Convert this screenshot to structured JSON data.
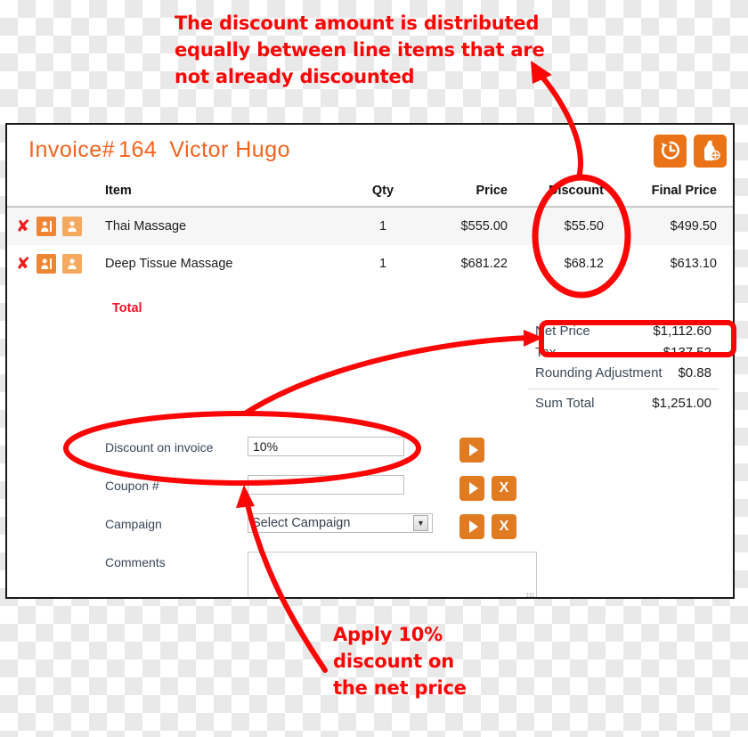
{
  "annotations": {
    "top_note": "The discount amount is distributed\nequally between line items that are\nnot already discounted",
    "bottom_note": "Apply 10%\ndiscount on\nthe net price",
    "color": "#fb0505"
  },
  "invoice": {
    "title_prefix": "Invoice#",
    "number": "164",
    "customer": "Victor Hugo",
    "title_color": "#f4631e",
    "header_buttons": [
      {
        "name": "history-button",
        "icon": "clock-history-icon"
      },
      {
        "name": "add-item-button",
        "icon": "bottle-plus-icon"
      }
    ],
    "table": {
      "columns": [
        "Item",
        "Qty",
        "Price",
        "Discount",
        "Final Price"
      ],
      "rows": [
        {
          "remove_icon": "x-icon",
          "staff_icon": "person-card-icon",
          "customer_icon": "person-icon",
          "item": "Thai Massage",
          "qty": "1",
          "price": "$555.00",
          "discount": "$55.50",
          "final_price": "$499.50"
        },
        {
          "remove_icon": "x-icon",
          "staff_icon": "person-card-icon",
          "customer_icon": "person-icon",
          "item": "Deep Tissue Massage",
          "qty": "1",
          "price": "$681.22",
          "discount": "$68.12",
          "final_price": "$613.10"
        }
      ],
      "total_label": "Total",
      "total_color": "#f2132b"
    },
    "summary": [
      {
        "label": "Net Price",
        "value": "$1,112.60",
        "highlighted": true
      },
      {
        "label": "Tax",
        "value": "$137.52",
        "highlighted": false
      },
      {
        "label": "Rounding Adjustment",
        "value": "$0.88",
        "highlighted": false
      },
      {
        "label": "Sum Total",
        "value": "$1,251.00",
        "highlighted": false
      }
    ],
    "form": {
      "discount_label": "Discount on invoice",
      "discount_value": "10%",
      "discount_placeholder": "",
      "coupon_label": "Coupon #",
      "coupon_value": "",
      "coupon_placeholder": "",
      "campaign_label": "Campaign",
      "campaign_selected": "Select Campaign",
      "comments_label": "Comments",
      "comments_value": "",
      "comments_placeholder": "",
      "apply_icon": "play-icon",
      "clear_label": "X"
    }
  }
}
